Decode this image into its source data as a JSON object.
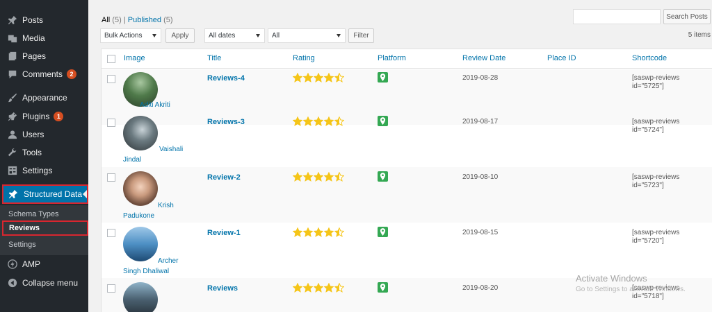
{
  "sidebar": {
    "items": [
      {
        "label": "Posts",
        "icon": "pin-icon"
      },
      {
        "label": "Media",
        "icon": "media-icon"
      },
      {
        "label": "Pages",
        "icon": "pages-icon"
      },
      {
        "label": "Comments",
        "icon": "comments-icon",
        "badge": "2"
      },
      {
        "label": "Appearance",
        "icon": "brush-icon"
      },
      {
        "label": "Plugins",
        "icon": "plugin-icon",
        "badge": "1"
      },
      {
        "label": "Users",
        "icon": "users-icon"
      },
      {
        "label": "Tools",
        "icon": "wrench-icon"
      },
      {
        "label": "Settings",
        "icon": "settings-icon"
      }
    ],
    "active": {
      "label": "Structured Data",
      "icon": "pin-icon"
    },
    "submenu": [
      "Schema Types",
      "Reviews",
      "Settings"
    ],
    "bottom": [
      {
        "label": "AMP",
        "icon": "amp-icon"
      },
      {
        "label": "Collapse menu",
        "icon": "collapse-icon"
      }
    ]
  },
  "filters": {
    "all_label": "All",
    "all_count": "(5)",
    "separator": "|",
    "published_label": "Published",
    "published_count": "(5)",
    "bulk_actions": "Bulk Actions",
    "apply": "Apply",
    "dates": "All dates",
    "all_select": "All",
    "filter": "Filter",
    "items_count": "5 items",
    "search_button": "Search Posts"
  },
  "table": {
    "headers": [
      "Image",
      "Title",
      "Rating",
      "Platform",
      "Review Date",
      "Place ID",
      "Shortcode"
    ],
    "rows": [
      {
        "author": "Aditi Akriti",
        "title": "Reviews-4",
        "date": "2019-08-28",
        "shortcode_1": "[saswp-reviews",
        "shortcode_2": "id=\"5725\"]",
        "rating": 4.5
      },
      {
        "author_1": "Vaishali",
        "author_2": "Jindal",
        "title": "Reviews-3",
        "date": "2019-08-17",
        "shortcode_1": "[saswp-reviews",
        "shortcode_2": "id=\"5724\"]",
        "rating": 4.5
      },
      {
        "author_1": "Krish",
        "author_2": "Padukone",
        "title": "Review-2",
        "date": "2019-08-10",
        "shortcode_1": "[saswp-reviews",
        "shortcode_2": "id=\"5723\"]",
        "rating": 4.5
      },
      {
        "author_1": "Archer",
        "author_2": "Singh Dhaliwal",
        "title": "Review-1",
        "date": "2019-08-15",
        "shortcode_1": "[saswp-reviews",
        "shortcode_2": "id=\"5720\"]",
        "rating": 4.5
      },
      {
        "title": "Reviews",
        "date": "2019-08-20",
        "shortcode_1": "[saswp-reviews",
        "shortcode_2": "id=\"5718\"]",
        "rating": 4.5
      }
    ]
  },
  "watermark": {
    "line1": "Activate Windows",
    "line2": "Go to Settings to activate Windows."
  },
  "colors": {
    "sidebar_bg": "#23282d",
    "active_bg": "#0073aa",
    "highlight_border": "#d9262f",
    "star": "#f5c518",
    "platform": "#34a853"
  }
}
